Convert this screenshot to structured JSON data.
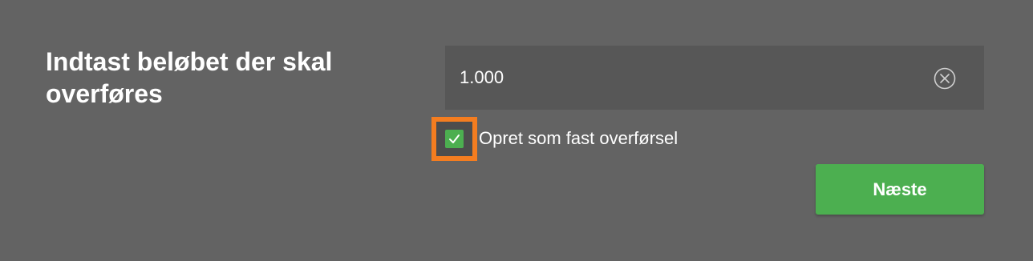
{
  "heading": "Indtast beløbet der skal overføres",
  "amount": {
    "value": "1.000",
    "clear_icon": "clear-circle-x-icon"
  },
  "recurring": {
    "checked": true,
    "label": "Opret som fast overførsel",
    "check_icon": "checkmark-icon"
  },
  "next_button": {
    "label": "Næste"
  },
  "colors": {
    "background": "#636363",
    "field_background": "#575757",
    "accent_green": "#4caf50",
    "highlight_orange": "#f47d20",
    "text": "#ffffff"
  }
}
